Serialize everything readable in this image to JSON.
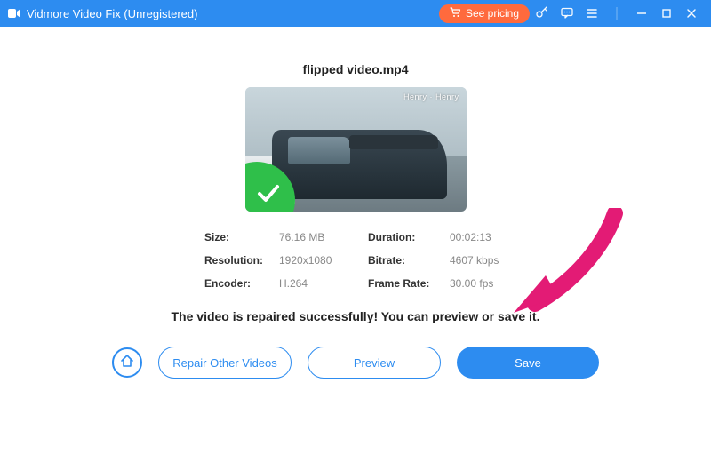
{
  "titlebar": {
    "app_title": "Vidmore Video Fix (Unregistered)",
    "see_pricing": "See pricing"
  },
  "file": {
    "name": "flipped video.mp4",
    "watermark": "Henry · Henry"
  },
  "meta": {
    "size_k": "Size:",
    "size_v": "76.16 MB",
    "duration_k": "Duration:",
    "duration_v": "00:02:13",
    "resolution_k": "Resolution:",
    "resolution_v": "1920x1080",
    "bitrate_k": "Bitrate:",
    "bitrate_v": "4607 kbps",
    "encoder_k": "Encoder:",
    "encoder_v": "H.264",
    "framerate_k": "Frame Rate:",
    "framerate_v": "30.00 fps"
  },
  "status_msg": "The video is repaired successfully! You can preview or save it.",
  "buttons": {
    "repair_other": "Repair Other Videos",
    "preview": "Preview",
    "save": "Save"
  },
  "colors": {
    "accent": "#2d8cf0",
    "cta": "#ff6a3d",
    "success": "#2fbf4a",
    "arrow": "#e31b75"
  }
}
